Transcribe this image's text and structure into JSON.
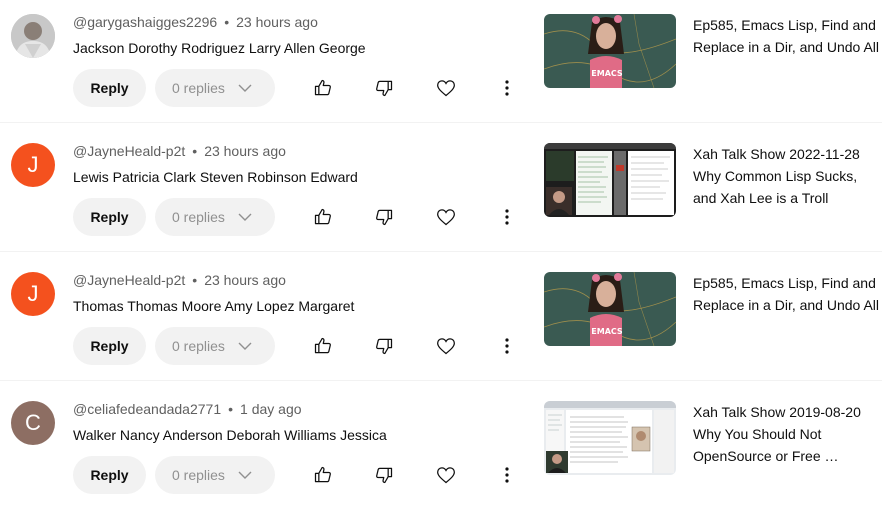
{
  "comments": [
    {
      "avatar_letter": "",
      "avatar_color": "#b9b9b9",
      "username": "@garygashaigges2296",
      "time": "23 hours ago",
      "text": "Jackson Dorothy Rodriguez Larry Allen George",
      "reply_label": "Reply",
      "replies_label": "0 replies",
      "video_title": "Ep585, Emacs Lisp, Find and Replace in a Dir, and Undo All",
      "thumbnail": "emacs-shirt",
      "thumb_text": "EMACS"
    },
    {
      "avatar_letter": "J",
      "avatar_color": "#f4511e",
      "username": "@JayneHeald-p2t",
      "time": "23 hours ago",
      "text": "Lewis Patricia Clark Steven Robinson Edward",
      "reply_label": "Reply",
      "replies_label": "0 replies",
      "video_title": "Xah Talk Show 2022-11-28 Why Common Lisp Sucks, and Xah Lee is a Troll",
      "thumbnail": "screen-dark",
      "thumb_text": ""
    },
    {
      "avatar_letter": "J",
      "avatar_color": "#f4511e",
      "username": "@JayneHeald-p2t",
      "time": "23 hours ago",
      "text": "Thomas Thomas Moore Amy Lopez Margaret",
      "reply_label": "Reply",
      "replies_label": "0 replies",
      "video_title": "Ep585, Emacs Lisp, Find and Replace in a Dir, and Undo All",
      "thumbnail": "emacs-shirt",
      "thumb_text": "EMACS"
    },
    {
      "avatar_letter": "C",
      "avatar_color": "#8d6e63",
      "username": "@celiafedeandada2771",
      "time": "1 day ago",
      "text": "Walker Nancy Anderson Deborah Williams Jessica",
      "reply_label": "Reply",
      "replies_label": "0 replies",
      "video_title": "Xah Talk Show 2019-08-20 Why You Should Not OpenSource or Free …",
      "thumbnail": "screen-light",
      "thumb_text": ""
    }
  ],
  "icons": {
    "like": "thumbs-up-icon",
    "dislike": "thumbs-down-icon",
    "heart": "heart-icon",
    "more": "more-vert-icon",
    "chevron": "chevron-down-icon"
  }
}
